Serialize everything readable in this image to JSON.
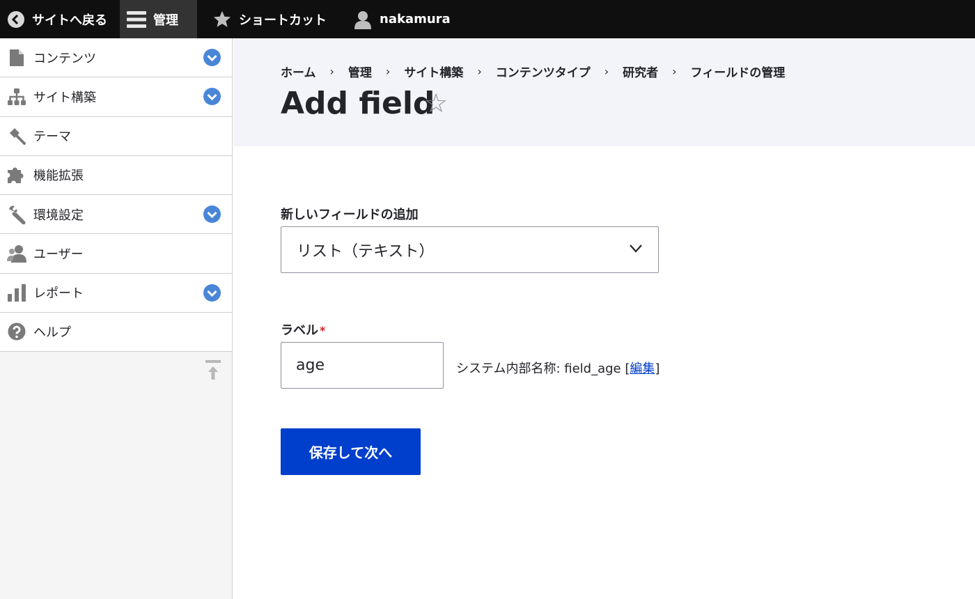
{
  "toolbar": {
    "back_label": "サイトへ戻る",
    "manage_label": "管理",
    "shortcut_label": "ショートカット",
    "user_label": "nakamura"
  },
  "sidebar": {
    "items": [
      {
        "label": "コンテンツ",
        "icon": "document-icon",
        "expandable": true
      },
      {
        "label": "サイト構築",
        "icon": "sitemap-icon",
        "expandable": true
      },
      {
        "label": "テーマ",
        "icon": "paintbrush-icon",
        "expandable": false
      },
      {
        "label": "機能拡張",
        "icon": "puzzle-icon",
        "expandable": false
      },
      {
        "label": "環境設定",
        "icon": "wrench-icon",
        "expandable": true
      },
      {
        "label": "ユーザー",
        "icon": "people-icon",
        "expandable": false
      },
      {
        "label": "レポート",
        "icon": "bar-chart-icon",
        "expandable": true
      },
      {
        "label": "ヘルプ",
        "icon": "help-icon",
        "expandable": false
      }
    ]
  },
  "breadcrumb": [
    "ホーム",
    "管理",
    "サイト構築",
    "コンテンツタイプ",
    "研究者",
    "フィールドの管理"
  ],
  "page": {
    "title": "Add field",
    "star_glyph": "☆"
  },
  "form": {
    "new_field_label": "新しいフィールドの追加",
    "new_field_value": "リスト（テキスト）",
    "label_label": "ラベル",
    "required_mark": "*",
    "label_value": "age",
    "machine_name_prefix": "システム内部名称: field_age [",
    "machine_name_edit": "編集",
    "machine_name_suffix": "]",
    "submit_label": "保存して次へ"
  },
  "colors": {
    "toolbar_bg": "#0f0f0f",
    "accent": "#003ecc",
    "chevron_badge": "#4a86d8",
    "header_bg": "#f3f4f9"
  }
}
